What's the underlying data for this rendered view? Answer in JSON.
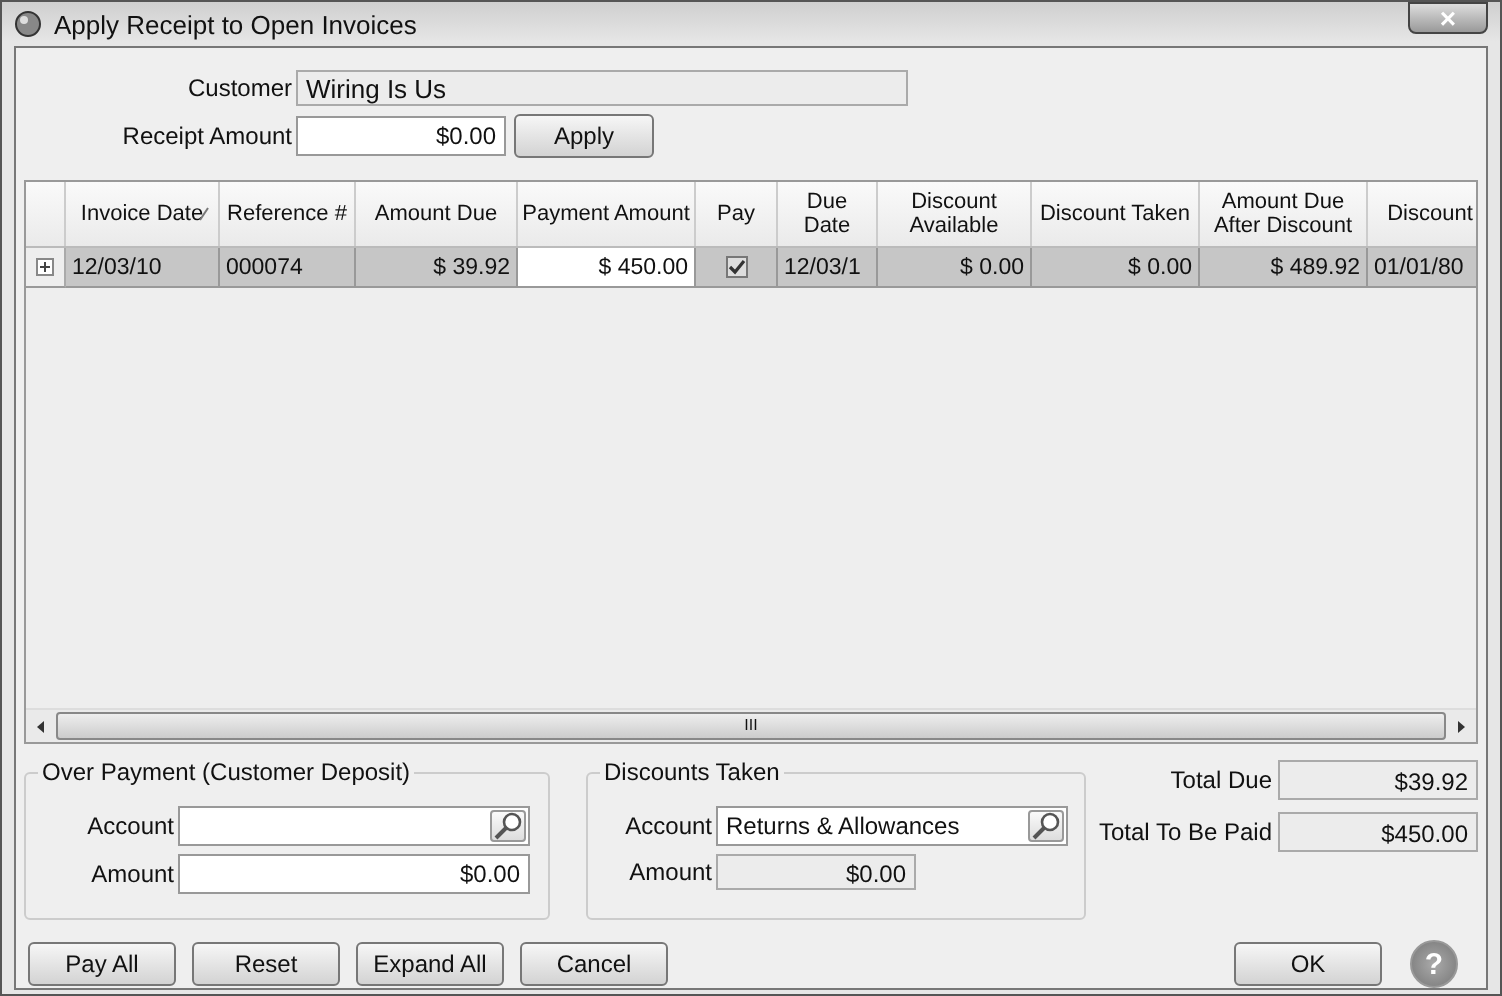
{
  "window": {
    "title": "Apply Receipt to Open Invoices",
    "close": "×"
  },
  "customer": {
    "label": "Customer",
    "value": "Wiring Is Us"
  },
  "receipt_amount": {
    "label": "Receipt Amount",
    "value": "$0.00",
    "button": "Apply"
  },
  "table": {
    "columns": [
      {
        "label": "Invoice Date",
        "sorted": true
      },
      {
        "label": "Reference #",
        "sorted": false
      },
      {
        "label": "Amount Due",
        "sorted": false
      },
      {
        "label": "Payment Amount",
        "sorted": false
      },
      {
        "label": "Pay",
        "sorted": false
      },
      {
        "label": "Due Date",
        "sorted": false
      },
      {
        "label": "Discount Available",
        "sorted": false
      },
      {
        "label": "Discount Taken",
        "sorted": false
      },
      {
        "label": "Amount Due After Discount",
        "sorted": false
      },
      {
        "label": "Discount",
        "sorted": false
      }
    ],
    "rows": [
      {
        "expanded": false,
        "selected": true,
        "cells": [
          "12/03/10",
          "000074",
          "$ 39.92",
          "$ 450.00",
          "",
          "12/03/1",
          "$ 0.00",
          "$ 0.00",
          "$ 489.92",
          "01/01/80"
        ],
        "pay_checked": true
      }
    ]
  },
  "scrollbar_grip": "III",
  "over_payment": {
    "title": "Over Payment (Customer Deposit)",
    "account_label": "Account",
    "amount_label": "Amount",
    "amount_value": "$0.00"
  },
  "discounts_taken": {
    "title": "Discounts Taken",
    "account_label": "Account",
    "account_value": "Returns & Allowances",
    "amount_label": "Amount",
    "amount_value": "$0.00"
  },
  "totals": [
    {
      "label": "Total Due",
      "value": "$39.92"
    },
    {
      "label": "Total To Be Paid",
      "value": "$450.00"
    }
  ],
  "buttons": [
    "Pay All",
    "Reset",
    "Expand All",
    "Cancel"
  ],
  "ok_button": "OK",
  "help": "?"
}
